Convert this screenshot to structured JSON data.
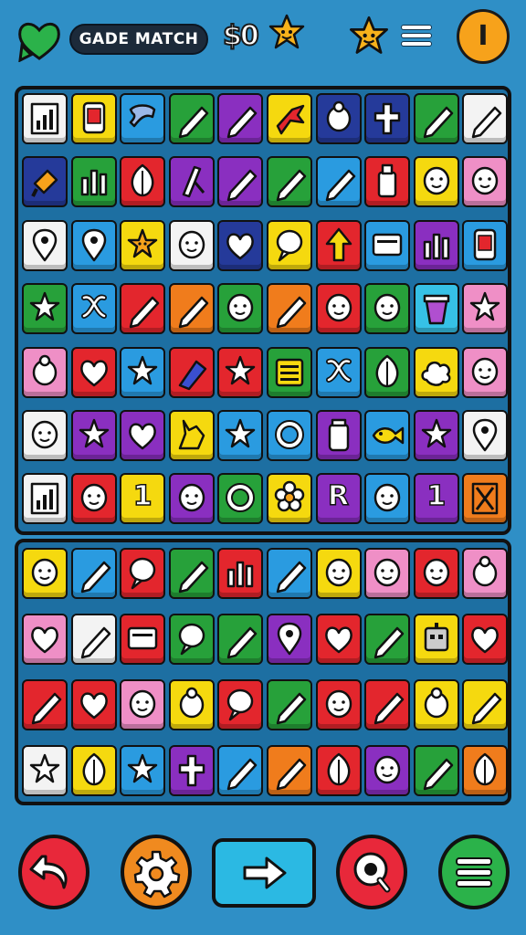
{
  "header": {
    "title": "GADE MATCH",
    "score": "$0",
    "icons": [
      "heart-icon",
      "star-face-icon",
      "star-face-icon",
      "menu-icon",
      "info-icon"
    ],
    "info_glyph": "I"
  },
  "colors": {
    "red": "#e3262d",
    "blue": "#2a9be0",
    "green": "#27a13a",
    "purple": "#8a2fc0",
    "yellow": "#f5d90f",
    "orange": "#f07c1c",
    "white": "#f3f3f3",
    "pink": "#ef8fc6",
    "navy": "#253a9a",
    "cyan": "#36c1e6",
    "magenta": "#c933c9"
  },
  "board_top": {
    "rows": [
      [
        [
          "white",
          "chart-icon"
        ],
        [
          "yellow",
          "phone-icon"
        ],
        [
          "blue",
          "shirt-icon"
        ],
        [
          "green",
          "pencil-icon"
        ],
        [
          "purple",
          "pencil-icon"
        ],
        [
          "yellow",
          "bird-icon"
        ],
        [
          "navy",
          "bug-icon"
        ],
        [
          "navy",
          "cross-icon"
        ],
        [
          "green",
          "pencil-icon"
        ],
        [
          "white",
          "pencil-icon"
        ]
      ],
      [
        [
          "navy",
          "stamp-icon"
        ],
        [
          "green",
          "bars-icon"
        ],
        [
          "red",
          "leaf-icon"
        ],
        [
          "purple",
          "compass-icon"
        ],
        [
          "purple",
          "pencil-icon"
        ],
        [
          "green",
          "pencil-icon"
        ],
        [
          "blue",
          "pencil-icon"
        ],
        [
          "red",
          "lighter-icon"
        ],
        [
          "yellow",
          "face-icon"
        ],
        [
          "pink",
          "face-icon"
        ]
      ],
      [
        [
          "white",
          "pin-icon"
        ],
        [
          "blue",
          "pin-icon"
        ],
        [
          "yellow",
          "star-face-icon"
        ],
        [
          "white",
          "face-icon"
        ],
        [
          "navy",
          "heart-icon"
        ],
        [
          "yellow",
          "balloon-icon"
        ],
        [
          "red",
          "arrow-icon"
        ],
        [
          "blue",
          "card-icon"
        ],
        [
          "purple",
          "bars-icon"
        ],
        [
          "blue",
          "phone-icon"
        ]
      ],
      [
        [
          "green",
          "star-icon"
        ],
        [
          "blue",
          "knot-icon"
        ],
        [
          "red",
          "pencil-icon"
        ],
        [
          "orange",
          "pencil-icon"
        ],
        [
          "green",
          "face-icon"
        ],
        [
          "orange",
          "pencil-icon"
        ],
        [
          "red",
          "face-icon"
        ],
        [
          "green",
          "face-icon"
        ],
        [
          "cyan",
          "cup-icon"
        ],
        [
          "pink",
          "star-icon"
        ]
      ],
      [
        [
          "pink",
          "bug-icon"
        ],
        [
          "red",
          "heart-icon"
        ],
        [
          "blue",
          "star-icon"
        ],
        [
          "red",
          "marker-icon"
        ],
        [
          "red",
          "star-icon"
        ],
        [
          "green",
          "list-icon"
        ],
        [
          "blue",
          "knot-icon"
        ],
        [
          "green",
          "leaf-icon"
        ],
        [
          "yellow",
          "cloud-icon"
        ],
        [
          "pink",
          "face-icon"
        ]
      ],
      [
        [
          "white",
          "face-icon"
        ],
        [
          "purple",
          "star-icon"
        ],
        [
          "purple",
          "heart-icon"
        ],
        [
          "yellow",
          "rabbit-icon"
        ],
        [
          "blue",
          "star-icon"
        ],
        [
          "blue",
          "ring-icon"
        ],
        [
          "purple",
          "jar-icon"
        ],
        [
          "blue",
          "fish-icon"
        ],
        [
          "purple",
          "star-icon"
        ],
        [
          "white",
          "pin-icon"
        ]
      ],
      [
        [
          "white",
          "chart-icon"
        ],
        [
          "red",
          "face-icon"
        ],
        [
          "yellow",
          "one-icon"
        ],
        [
          "purple",
          "face-icon"
        ],
        [
          "green",
          "ring-icon"
        ],
        [
          "yellow",
          "flower-icon"
        ],
        [
          "purple",
          "letter-icon"
        ],
        [
          "blue",
          "face-icon"
        ],
        [
          "purple",
          "one-icon"
        ],
        [
          "orange",
          "flag-icon"
        ]
      ]
    ],
    "glyphs": {
      "one-icon": "1",
      "letter-icon": "R"
    }
  },
  "board_bottom": {
    "rows": [
      [
        [
          "yellow",
          "face-icon"
        ],
        [
          "blue",
          "pencil-icon"
        ],
        [
          "red",
          "balloon-icon"
        ],
        [
          "green",
          "pencil-icon"
        ],
        [
          "red",
          "bars-icon"
        ],
        [
          "blue",
          "pencil-icon"
        ],
        [
          "yellow",
          "face-icon"
        ],
        [
          "pink",
          "face-icon"
        ],
        [
          "red",
          "face-icon"
        ],
        [
          "pink",
          "bug-icon"
        ]
      ],
      [
        [
          "pink",
          "heart-icon"
        ],
        [
          "white",
          "pencil-icon"
        ],
        [
          "red",
          "card-icon"
        ],
        [
          "green",
          "balloon-icon"
        ],
        [
          "green",
          "pencil-icon"
        ],
        [
          "purple",
          "pin-icon"
        ],
        [
          "red",
          "heart-icon"
        ],
        [
          "green",
          "pencil-icon"
        ],
        [
          "yellow",
          "robot-icon"
        ],
        [
          "red",
          "heart-icon"
        ]
      ],
      [
        [
          "red",
          "pencil-icon"
        ],
        [
          "red",
          "heart-icon"
        ],
        [
          "pink",
          "face-icon"
        ],
        [
          "yellow",
          "bug-icon"
        ],
        [
          "red",
          "balloon-icon"
        ],
        [
          "green",
          "pencil-icon"
        ],
        [
          "red",
          "face-icon"
        ],
        [
          "red",
          "pencil-icon"
        ],
        [
          "yellow",
          "bug-icon"
        ],
        [
          "yellow",
          "pencil-icon"
        ]
      ],
      [
        [
          "white",
          "star-icon"
        ],
        [
          "yellow",
          "leaf-icon"
        ],
        [
          "blue",
          "star-icon"
        ],
        [
          "purple",
          "cross-icon"
        ],
        [
          "blue",
          "pencil-icon"
        ],
        [
          "orange",
          "pencil-icon"
        ],
        [
          "red",
          "leaf-icon"
        ],
        [
          "purple",
          "face-icon"
        ],
        [
          "green",
          "pencil-icon"
        ],
        [
          "orange",
          "leaf-icon"
        ]
      ]
    ]
  },
  "bottom_bar": {
    "buttons": [
      "undo-icon",
      "gear-icon",
      "arrow-right-icon",
      "search-icon",
      "menu-icon"
    ]
  }
}
